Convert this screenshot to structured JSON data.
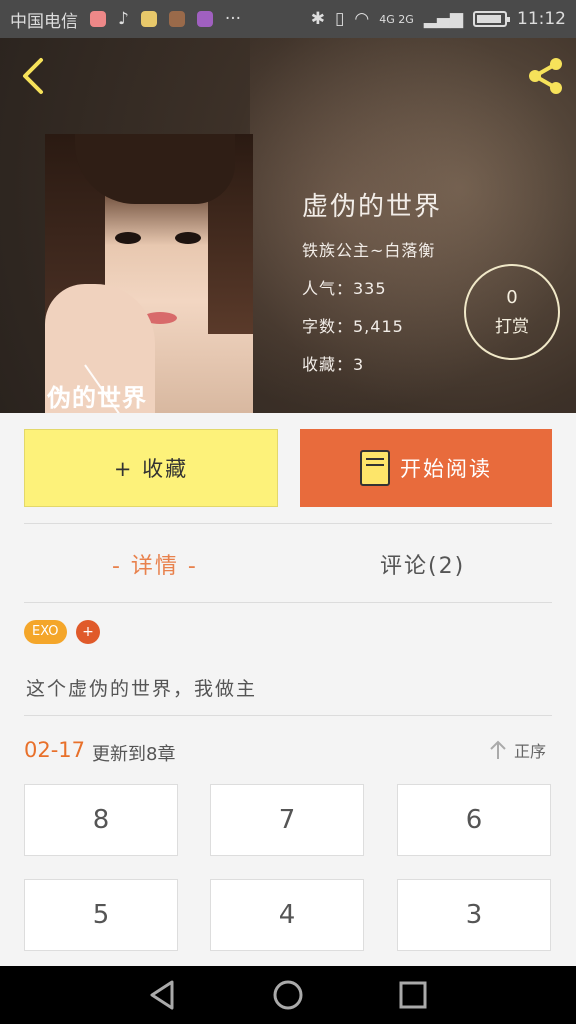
{
  "status_bar": {
    "carrier": "中国电信",
    "network": "4G 2G",
    "time": "11:12",
    "more": "···"
  },
  "book": {
    "title": "虚伪的世界",
    "author": "铁族公主~白落衡",
    "popularity": "人气：335",
    "word_count": "字数：5,415",
    "favorites": "收藏：3",
    "cover_text": "伪的世界"
  },
  "reward": {
    "count": "0",
    "label": "打赏"
  },
  "actions": {
    "collect_label": "+ 收藏",
    "read_label": "开始阅读"
  },
  "tabs": {
    "details": "- 详情 -",
    "comments": "评论(2)"
  },
  "tags": {
    "tag1": "EXO",
    "add": "+"
  },
  "description": "这个虚伪的世界，我做主",
  "update": {
    "date": "02-17",
    "text": "更新到8章",
    "sort_label": "正序"
  },
  "chapters": [
    "8",
    "7",
    "6",
    "5",
    "4",
    "3"
  ],
  "colors": {
    "accent_orange": "#e86b3c",
    "collect_yellow": "#fdf27a",
    "tag_orange": "#f4a62a"
  },
  "icons": {
    "back": "chevron-left-icon",
    "share": "share-icon",
    "book": "book-icon",
    "sort": "arrow-up-icon",
    "nav_back": "triangle-back-icon",
    "nav_home": "circle-home-icon",
    "nav_recent": "square-recent-icon"
  }
}
